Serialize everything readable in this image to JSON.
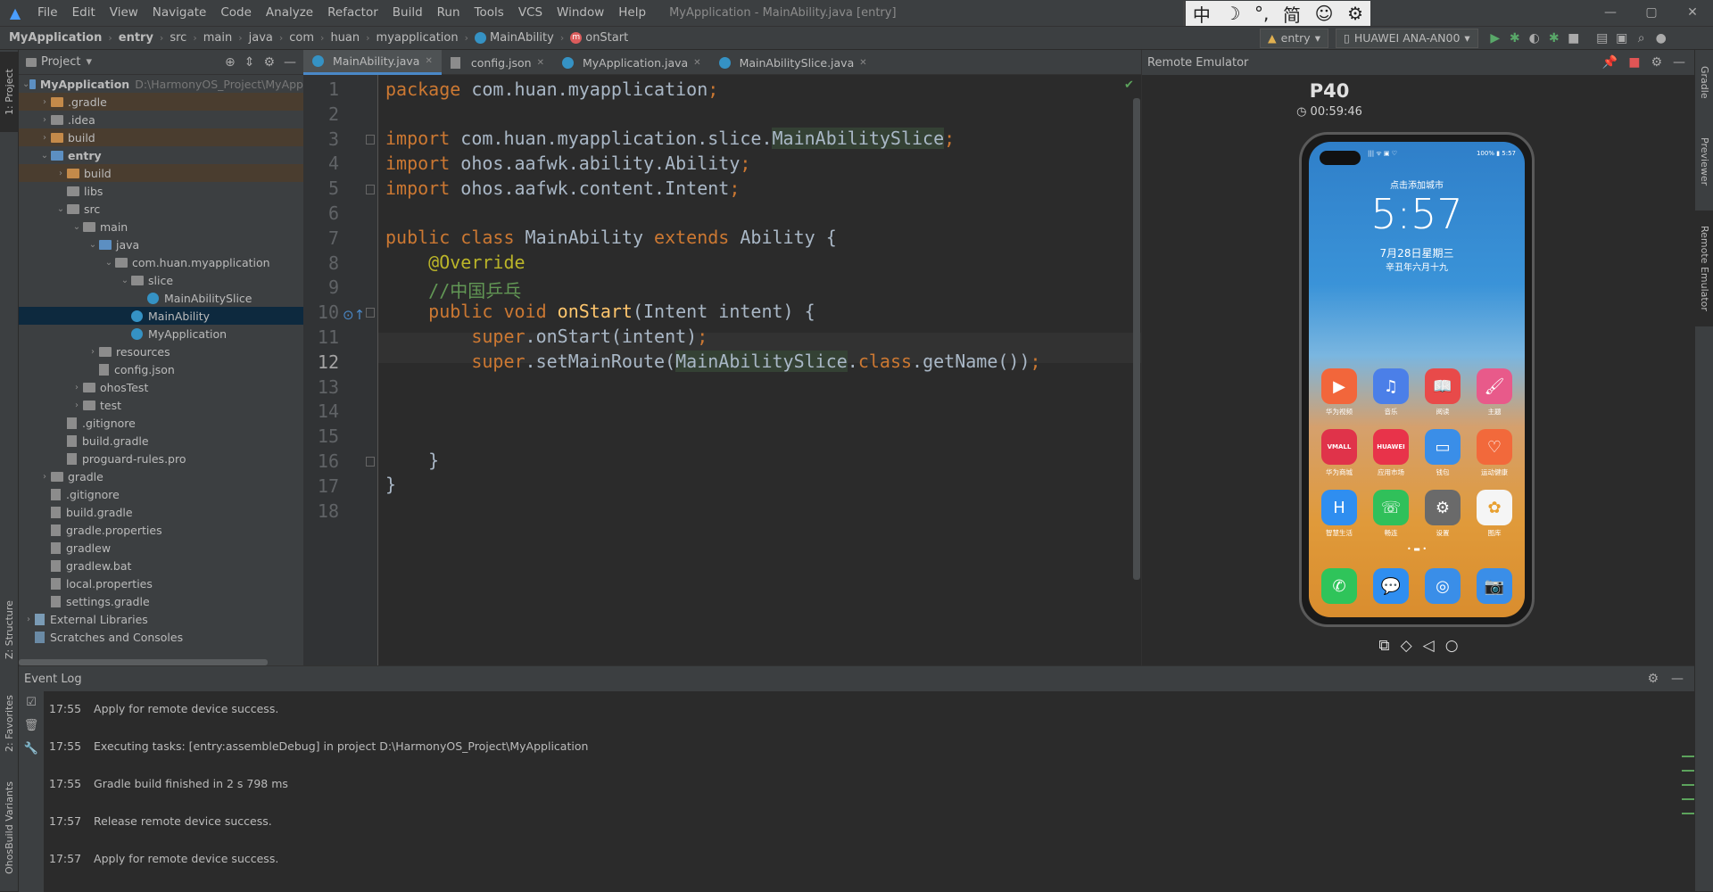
{
  "menubar": {
    "items": [
      "File",
      "Edit",
      "View",
      "Navigate",
      "Code",
      "Analyze",
      "Refactor",
      "Build",
      "Run",
      "Tools",
      "VCS",
      "Window",
      "Help"
    ],
    "window_title": "MyApplication - MainAbility.java [entry]",
    "ime": [
      "中",
      "☽",
      "°,",
      "简",
      "☺",
      "⚙"
    ],
    "winctl": [
      "—",
      "▢",
      "✕"
    ]
  },
  "breadcrumbs": [
    "MyApplication",
    "entry",
    "src",
    "main",
    "java",
    "com",
    "huan",
    "myapplication",
    "MainAbility",
    "onStart"
  ],
  "toolbar": {
    "run_config": "entry",
    "device": "HUAWEI ANA-AN00"
  },
  "left_strip": {
    "project": "1: Project",
    "structure": "Z: Structure",
    "favorites": "2: Favorites",
    "variants": "OhosBuild Variants"
  },
  "right_strip": {
    "gradle": "Gradle",
    "previewer": "Previewer",
    "remote": "Remote Emulator"
  },
  "project": {
    "title": "Project",
    "root_path": "D:\\HarmonyOS_Project\\MyApp",
    "tree": [
      {
        "label": "MyApplication",
        "depth": 0,
        "arrow": "v",
        "icon": "b",
        "bold": true
      },
      {
        "label": ".gradle",
        "depth": 1,
        "arrow": ">",
        "icon": "o",
        "hl": true
      },
      {
        "label": ".idea",
        "depth": 1,
        "arrow": ">",
        "icon": "g"
      },
      {
        "label": "build",
        "depth": 1,
        "arrow": ">",
        "icon": "o",
        "hl": true
      },
      {
        "label": "entry",
        "depth": 1,
        "arrow": "v",
        "icon": "b",
        "bold": true
      },
      {
        "label": "build",
        "depth": 2,
        "arrow": ">",
        "icon": "o",
        "hl": true
      },
      {
        "label": "libs",
        "depth": 2,
        "arrow": "",
        "icon": "g"
      },
      {
        "label": "src",
        "depth": 2,
        "arrow": "v",
        "icon": "g"
      },
      {
        "label": "main",
        "depth": 3,
        "arrow": "v",
        "icon": "g"
      },
      {
        "label": "java",
        "depth": 4,
        "arrow": "v",
        "icon": "b"
      },
      {
        "label": "com.huan.myapplication",
        "depth": 5,
        "arrow": "v",
        "icon": "g"
      },
      {
        "label": "slice",
        "depth": 6,
        "arrow": "v",
        "icon": "g"
      },
      {
        "label": "MainAbilitySlice",
        "depth": 7,
        "arrow": "",
        "icon": "c"
      },
      {
        "label": "MainAbility",
        "depth": 6,
        "arrow": "",
        "icon": "c",
        "sel": true
      },
      {
        "label": "MyApplication",
        "depth": 6,
        "arrow": "",
        "icon": "c"
      },
      {
        "label": "resources",
        "depth": 4,
        "arrow": ">",
        "icon": "g"
      },
      {
        "label": "config.json",
        "depth": 4,
        "arrow": "",
        "icon": "f"
      },
      {
        "label": "ohosTest",
        "depth": 3,
        "arrow": ">",
        "icon": "g"
      },
      {
        "label": "test",
        "depth": 3,
        "arrow": ">",
        "icon": "g"
      },
      {
        "label": ".gitignore",
        "depth": 2,
        "arrow": "",
        "icon": "f"
      },
      {
        "label": "build.gradle",
        "depth": 2,
        "arrow": "",
        "icon": "f"
      },
      {
        "label": "proguard-rules.pro",
        "depth": 2,
        "arrow": "",
        "icon": "f"
      },
      {
        "label": "gradle",
        "depth": 1,
        "arrow": ">",
        "icon": "g"
      },
      {
        "label": ".gitignore",
        "depth": 1,
        "arrow": "",
        "icon": "f"
      },
      {
        "label": "build.gradle",
        "depth": 1,
        "arrow": "",
        "icon": "f"
      },
      {
        "label": "gradle.properties",
        "depth": 1,
        "arrow": "",
        "icon": "f"
      },
      {
        "label": "gradlew",
        "depth": 1,
        "arrow": "",
        "icon": "f"
      },
      {
        "label": "gradlew.bat",
        "depth": 1,
        "arrow": "",
        "icon": "f"
      },
      {
        "label": "local.properties",
        "depth": 1,
        "arrow": "",
        "icon": "f"
      },
      {
        "label": "settings.gradle",
        "depth": 1,
        "arrow": "",
        "icon": "f"
      },
      {
        "label": "External Libraries",
        "depth": 0,
        "arrow": ">",
        "icon": "l"
      },
      {
        "label": "Scratches and Consoles",
        "depth": 0,
        "arrow": "",
        "icon": "s"
      }
    ]
  },
  "tabs": [
    "MainAbility.java",
    "config.json",
    "MyApplication.java",
    "MainAbilitySlice.java"
  ],
  "editor": {
    "line_numbers": [
      "1",
      "2",
      "3",
      "4",
      "5",
      "6",
      "7",
      "8",
      "9",
      "10",
      "11",
      "12",
      "13",
      "14",
      "15",
      "16",
      "17",
      "18"
    ],
    "current_line": 12
  },
  "emulator": {
    "title": "Remote Emulator",
    "device": "P40",
    "timer": "00:59:46",
    "status_left": "||| ᯤ ▣ ♡",
    "status_right": "100% ▮ 5:57",
    "city": "点击添加城市",
    "clock": "5:57",
    "date": "7月28日星期三",
    "lunar": "辛丑年六月十九",
    "apps_row1": [
      {
        "name": "华为视频",
        "color": "#f2663b",
        "glyph": "▶"
      },
      {
        "name": "音乐",
        "color": "#4b7fe8",
        "glyph": "♫"
      },
      {
        "name": "阅读",
        "color": "#e84a4a",
        "glyph": "📖"
      },
      {
        "name": "主题",
        "color": "#e85a8a",
        "glyph": "🖌"
      }
    ],
    "apps_row2": [
      {
        "name": "华为商城",
        "color": "#e0334a",
        "glyph": "VMALL"
      },
      {
        "name": "应用市场",
        "color": "#e8334a",
        "glyph": "HUAWEI"
      },
      {
        "name": "钱包",
        "color": "#3a8ee8",
        "glyph": "▭"
      },
      {
        "name": "运动健康",
        "color": "#f2693b",
        "glyph": "♡"
      }
    ],
    "apps_row3": [
      {
        "name": "智慧生活",
        "color": "#2f8ef0",
        "glyph": "H"
      },
      {
        "name": "畅连",
        "color": "#30c05a",
        "glyph": "☏"
      },
      {
        "name": "设置",
        "color": "#6a6a6a",
        "glyph": "⚙"
      },
      {
        "name": "图库",
        "color": "#f5f5f5",
        "glyph": "✿"
      }
    ],
    "dock": [
      {
        "color": "#2fc45a",
        "glyph": "✆"
      },
      {
        "color": "#2f8ef0",
        "glyph": "💬"
      },
      {
        "color": "#3a8ee8",
        "glyph": "◎"
      },
      {
        "color": "#3a8ee8",
        "glyph": "📷"
      }
    ],
    "navkeys": [
      "⧉",
      "◇",
      "◁",
      "○"
    ]
  },
  "event_log": {
    "title": "Event Log",
    "entries": [
      {
        "time": "17:55",
        "text": "Apply for remote device success."
      },
      {
        "time": "17:55",
        "text": "Executing tasks: [entry:assembleDebug] in project D:\\HarmonyOS_Project\\MyApplication"
      },
      {
        "time": "17:55",
        "text": "Gradle build finished in 2 s 798 ms"
      },
      {
        "time": "17:57",
        "text": "Release remote device success."
      },
      {
        "time": "17:57",
        "text": "Apply for remote device success."
      }
    ]
  }
}
